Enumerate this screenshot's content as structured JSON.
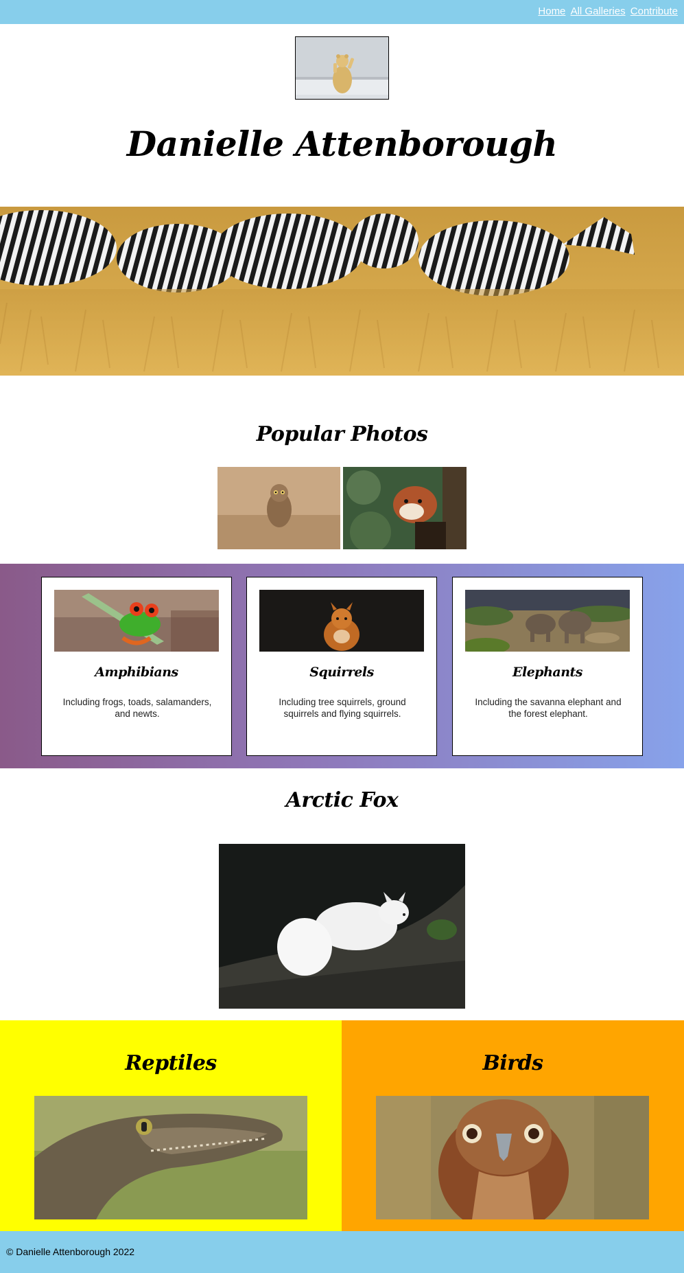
{
  "nav": {
    "links": [
      {
        "label": "Home"
      },
      {
        "label": "All Galleries"
      },
      {
        "label": "Contribute"
      }
    ]
  },
  "site": {
    "title": "Danielle Attenborough"
  },
  "popular": {
    "heading": "Popular Photos"
  },
  "categories": [
    {
      "title": "Amphibians",
      "description": "Including frogs, toads, salamanders, and newts."
    },
    {
      "title": "Squirrels",
      "description": "Including tree squirrels, ground squirrels and flying squirrels."
    },
    {
      "title": "Elephants",
      "description": "Including the savanna elephant and the forest elephant."
    }
  ],
  "feature": {
    "heading": "Arctic Fox"
  },
  "panels": [
    {
      "title": "Reptiles",
      "color": "#ffff00"
    },
    {
      "title": "Birds",
      "color": "#ffa500"
    }
  ],
  "footer": {
    "text": "© Danielle Attenborough 2022"
  },
  "colors": {
    "nav_bg": "#87ceeb",
    "footer_bg": "#87ceeb",
    "gradient_start": "#8a5a89",
    "gradient_end": "#87a2ea"
  }
}
